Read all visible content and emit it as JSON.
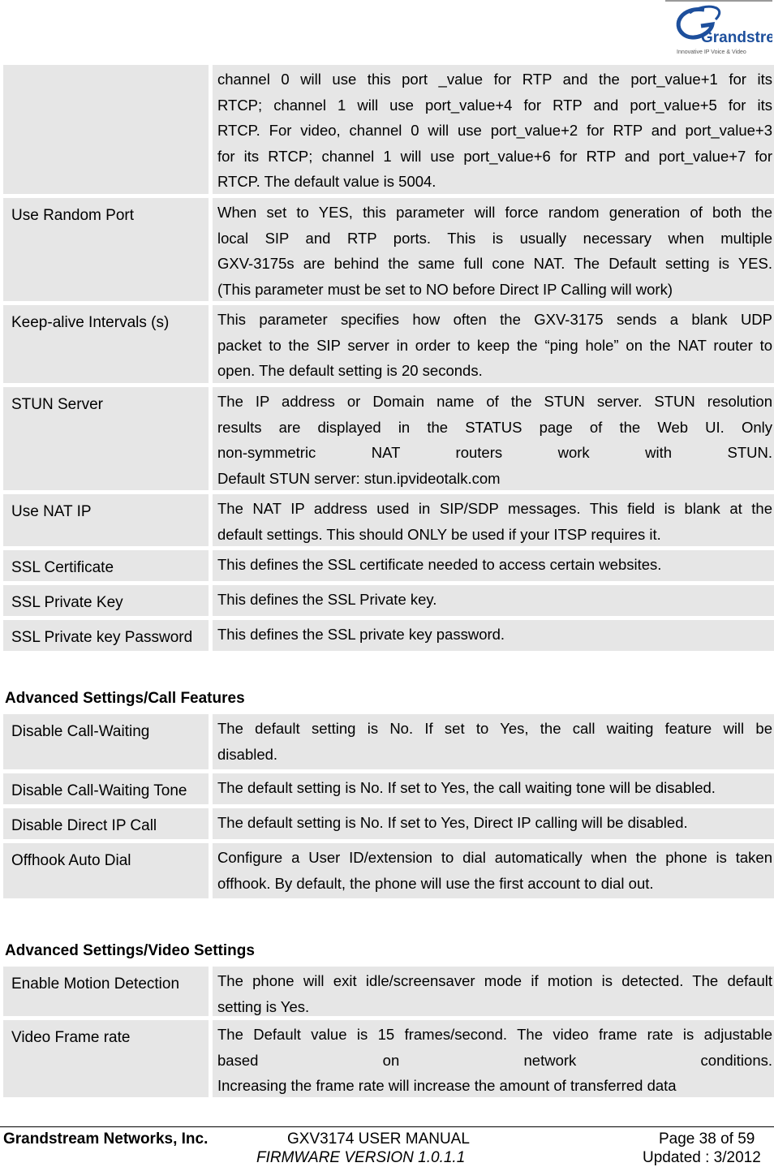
{
  "logo": {
    "brand": "Grandstream",
    "tagline": "Innovative IP Voice & Video"
  },
  "table1": {
    "rows": [
      {
        "name": "",
        "desc": [
          "channel 0 will use this port _value for RTP and the port_value+1 for its",
          "RTCP; channel 1 will use port_value+4 for RTP and port_value+5 for its",
          "RTCP. For video, channel 0 will use port_value+2 for RTP and port_value+3",
          "for its RTCP; channel 1 will use port_value+6 for RTP and port_value+7 for",
          "RTCP. The default value is 5004."
        ]
      },
      {
        "name": "Use Random Port",
        "desc": [
          "When set to YES, this parameter will force random generation of both the",
          "local SIP and RTP ports. This is usually necessary when multiple",
          "GXV-3175s are behind the same full cone NAT. The Default setting is YES.",
          "(This parameter must be set to NO before Direct IP Calling will work)"
        ]
      },
      {
        "name": "Keep-alive Intervals (s)",
        "desc": [
          "This parameter specifies how often the GXV-3175 sends a blank UDP",
          "packet to the SIP server in order to keep the “ping hole” on the NAT router to",
          "open. The default setting is 20 seconds."
        ]
      },
      {
        "name": "STUN Server",
        "desc": [
          "The IP address or Domain name of the STUN server. STUN resolution",
          "results are displayed in the STATUS page of the Web UI. Only",
          "non-symmetric NAT routers work with STUN.",
          "Default STUN server: stun.ipvideotalk.com"
        ]
      },
      {
        "name": "Use NAT IP",
        "desc": [
          "The NAT IP address used in SIP/SDP messages. This field is blank at the",
          "default settings. This should ONLY be used if your ITSP requires it."
        ]
      },
      {
        "name": "SSL Certificate",
        "desc": [
          "This defines the SSL certificate needed to access certain websites."
        ]
      },
      {
        "name": "SSL Private Key",
        "desc": [
          "This defines the SSL Private key."
        ]
      },
      {
        "name": "SSL Private key Password",
        "desc": [
          "This defines the SSL private key password."
        ]
      }
    ]
  },
  "section2": {
    "heading": "Advanced Settings/Call Features",
    "rows": [
      {
        "name": "Disable Call-Waiting",
        "desc": [
          "The default setting is No. If set to Yes, the call waiting feature will be",
          "disabled."
        ]
      },
      {
        "name": "Disable Call-Waiting Tone",
        "desc": [
          "The default setting is No. If set to Yes, the call waiting tone will be disabled."
        ]
      },
      {
        "name": "Disable Direct IP Call",
        "desc": [
          "The default setting is No. If set to Yes, Direct IP calling will be disabled."
        ]
      },
      {
        "name": "Offhook Auto Dial",
        "desc": [
          "Configure a User ID/extension to dial automatically when the phone is taken",
          "offhook. By default, the phone will use the first account to dial out."
        ]
      }
    ]
  },
  "section3": {
    "heading": "Advanced Settings/Video Settings",
    "rows": [
      {
        "name": "Enable Motion Detection",
        "desc": [
          "The phone will exit idle/screensaver mode if motion is detected. The default",
          "setting is Yes."
        ]
      },
      {
        "name": "Video Frame rate",
        "desc": [
          "The Default value is 15 frames/second. The video frame rate is adjustable",
          "based on network conditions.",
          "Increasing the frame rate will increase the amount of transferred data"
        ]
      }
    ]
  },
  "footer": {
    "company": "Grandstream Networks, Inc.",
    "manual": "GXV3174 USER MANUAL",
    "firmware": "FIRMWARE VERSION 1.0.1.1",
    "page": "Page 38 of 59",
    "updated": "Updated : 3/2012"
  }
}
